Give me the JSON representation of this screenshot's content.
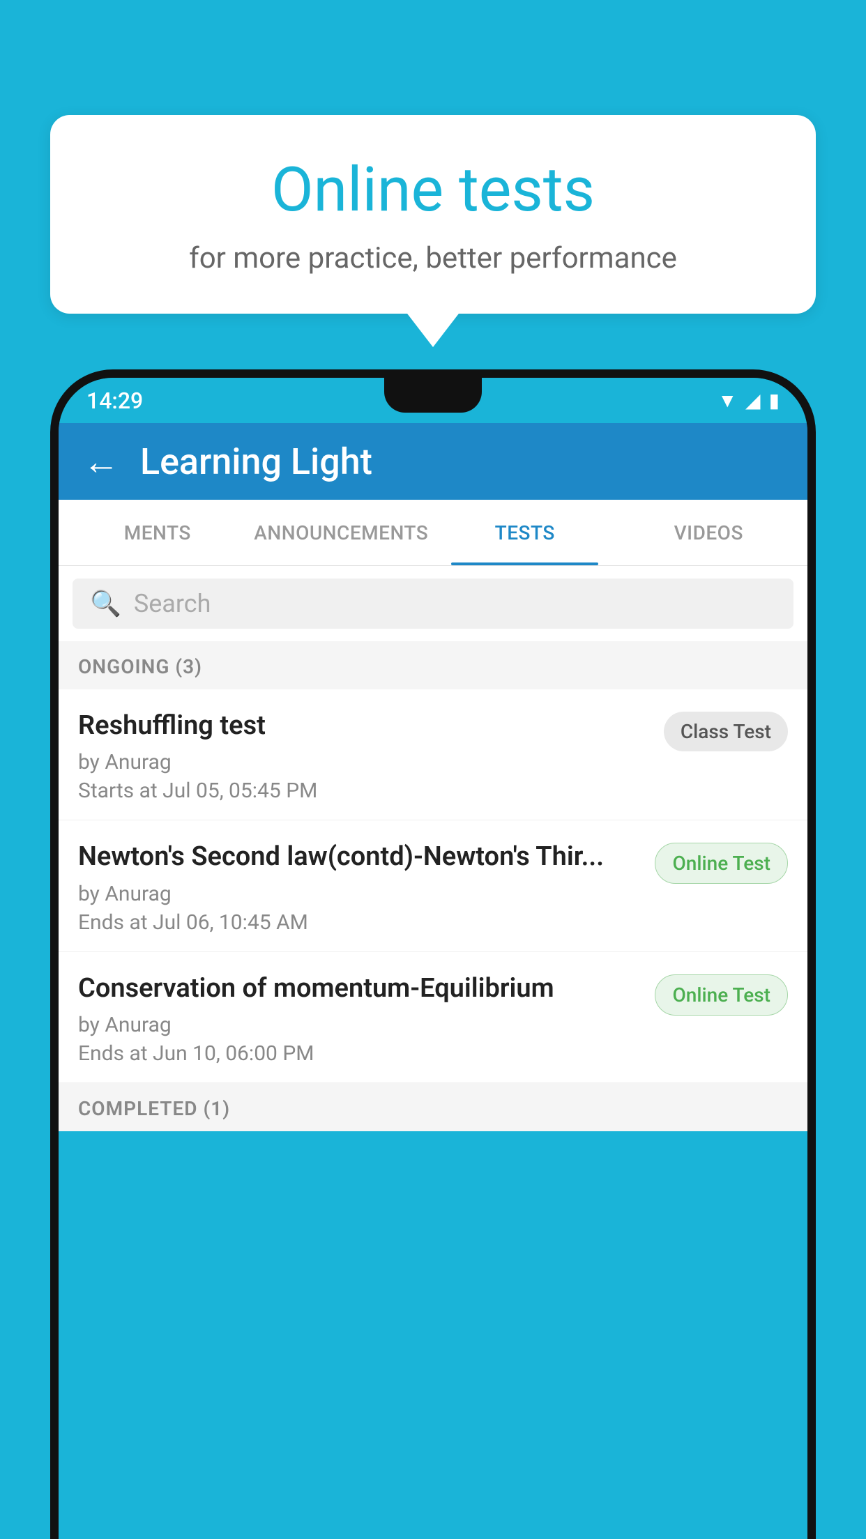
{
  "background": {
    "color": "#1ab4d8"
  },
  "speech_bubble": {
    "title": "Online tests",
    "subtitle": "for more practice, better performance"
  },
  "phone": {
    "status_bar": {
      "time": "14:29",
      "icons": [
        "wifi",
        "signal",
        "battery"
      ]
    },
    "app_bar": {
      "title": "Learning Light",
      "back_label": "←"
    },
    "tabs": [
      {
        "label": "MENTS",
        "active": false
      },
      {
        "label": "ANNOUNCEMENTS",
        "active": false
      },
      {
        "label": "TESTS",
        "active": true
      },
      {
        "label": "VIDEOS",
        "active": false
      }
    ],
    "search": {
      "placeholder": "Search"
    },
    "sections": [
      {
        "label": "ONGOING (3)",
        "tests": [
          {
            "name": "Reshuffling test",
            "by": "by Anurag",
            "time": "Starts at  Jul 05, 05:45 PM",
            "badge": "Class Test",
            "badge_type": "class"
          },
          {
            "name": "Newton's Second law(contd)-Newton's Thir...",
            "by": "by Anurag",
            "time": "Ends at  Jul 06, 10:45 AM",
            "badge": "Online Test",
            "badge_type": "online"
          },
          {
            "name": "Conservation of momentum-Equilibrium",
            "by": "by Anurag",
            "time": "Ends at  Jun 10, 06:00 PM",
            "badge": "Online Test",
            "badge_type": "online"
          }
        ]
      }
    ],
    "completed_label": "COMPLETED (1)"
  }
}
